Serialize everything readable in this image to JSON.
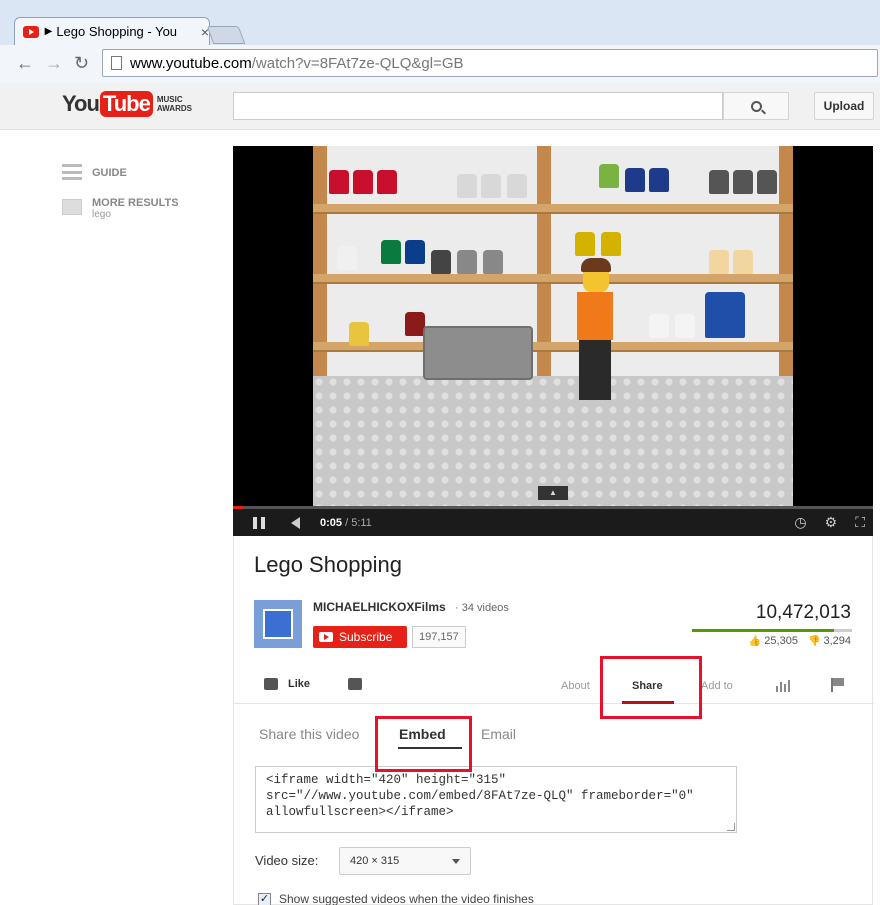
{
  "browser": {
    "tab_title": "Lego Shopping - You",
    "tab_close": "×",
    "url_host": "www.youtube.com",
    "url_path": "/watch?v=8FAt7ze-QLQ&gl=GB",
    "back": "←",
    "forward": "→",
    "reload": "↻"
  },
  "header": {
    "logo_you": "You",
    "logo_tube": "Tube",
    "logo_awards": "MUSIC AWARDS",
    "search_placeholder": "",
    "upload_label": "Upload"
  },
  "guide": {
    "guide_label": "GUIDE",
    "more_results_label": "MORE RESULTS",
    "more_results_sub": "lego"
  },
  "player": {
    "current_time": "0:05",
    "duration": "/ 5:11",
    "progress_fraction": 0.016
  },
  "video": {
    "title": "Lego Shopping",
    "channel": "MICHAELHICKOXFilms",
    "video_count": "· 34 videos",
    "subscribe_label": "Subscribe",
    "subscriber_count": "197,157",
    "views": "10,472,013",
    "likes": "25,305",
    "dislikes": "3,294"
  },
  "actions": {
    "like_label": "Like",
    "about_label": "About",
    "share_label": "Share",
    "add_to_label": "Add to"
  },
  "share": {
    "tab_share_video": "Share this video",
    "tab_embed": "Embed",
    "tab_email": "Email",
    "embed_line1": "<iframe width=\"420\" height=\"315\"",
    "embed_line2": "src=\"//www.youtube.com/embed/8FAt7ze-QLQ\" frameborder=\"0\"",
    "embed_line3": "allowfullscreen></iframe>",
    "video_size_label": "Video size:",
    "video_size_value": "420 × 315",
    "suggest_label": "Show suggested videos when the video finishes"
  },
  "colors": {
    "brand_red": "#e62117",
    "highlight_red": "#e8112d",
    "like_green": "#559900"
  }
}
